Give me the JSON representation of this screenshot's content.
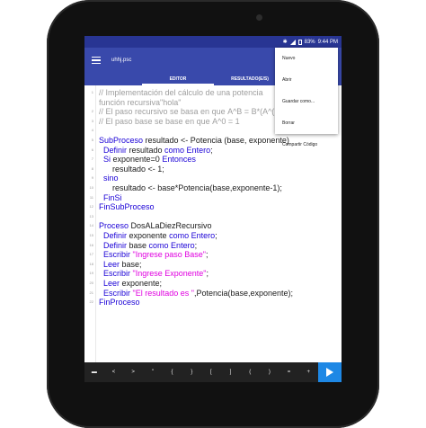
{
  "status": {
    "bt": "✱",
    "battery": "83%",
    "time": "9:44 PM"
  },
  "appbar": {
    "filename": "uhhj.psc"
  },
  "tabs": [
    "EDITOR",
    "RESULTADO(E/S)"
  ],
  "menu": [
    "Nuevo",
    "Abrir",
    "Guardar como...",
    "Borrar",
    "Compartir Código"
  ],
  "code_lines": [
    {
      "n": "1",
      "parts": [
        {
          "c": "cm",
          "t": "// Implementación del cálculo de una potencia"
        }
      ]
    },
    {
      "n": "",
      "parts": [
        {
          "c": "cm",
          "t": "función recursiva\"hola\""
        }
      ]
    },
    {
      "n": "2",
      "parts": [
        {
          "c": "cm",
          "t": "// El paso recursivo se basa en que A^B = B*(A^("
        }
      ]
    },
    {
      "n": "3",
      "parts": [
        {
          "c": "cm",
          "t": "// El paso base se base en que A^0 = 1"
        }
      ]
    },
    {
      "n": "4",
      "parts": []
    },
    {
      "n": "5",
      "parts": [
        {
          "c": "kw",
          "t": "SubProceso"
        },
        {
          "c": "nm",
          "t": " resultado <- Potencia (base, exponente)"
        }
      ]
    },
    {
      "n": "6",
      "parts": [
        {
          "c": "kw",
          "t": "  Definir"
        },
        {
          "c": "nm",
          "t": " resultado "
        },
        {
          "c": "kw",
          "t": "como Entero"
        },
        {
          "c": "nm",
          "t": ";"
        }
      ]
    },
    {
      "n": "7",
      "parts": [
        {
          "c": "kw",
          "t": "  Si"
        },
        {
          "c": "nm",
          "t": " exponente=0 "
        },
        {
          "c": "kw",
          "t": "Entonces"
        }
      ]
    },
    {
      "n": "8",
      "parts": [
        {
          "c": "nm",
          "t": "      resultado <- 1;"
        }
      ]
    },
    {
      "n": "9",
      "parts": [
        {
          "c": "kw",
          "t": "  sino"
        }
      ]
    },
    {
      "n": "10",
      "parts": [
        {
          "c": "nm",
          "t": "      resultado <- base*Potencia(base,exponente-1);"
        }
      ]
    },
    {
      "n": "11",
      "parts": [
        {
          "c": "kw",
          "t": "  FinSi"
        }
      ]
    },
    {
      "n": "12",
      "parts": [
        {
          "c": "kw",
          "t": "FinSubProceso"
        }
      ]
    },
    {
      "n": "13",
      "parts": []
    },
    {
      "n": "14",
      "parts": [
        {
          "c": "kw",
          "t": "Proceso"
        },
        {
          "c": "nm",
          "t": " DosALaDiezRecursivo"
        }
      ]
    },
    {
      "n": "15",
      "parts": [
        {
          "c": "kw",
          "t": "  Definir"
        },
        {
          "c": "nm",
          "t": " exponente "
        },
        {
          "c": "kw",
          "t": "como Entero"
        },
        {
          "c": "nm",
          "t": ";"
        }
      ]
    },
    {
      "n": "16",
      "parts": [
        {
          "c": "kw",
          "t": "  Definir"
        },
        {
          "c": "nm",
          "t": " base "
        },
        {
          "c": "kw",
          "t": "como Entero"
        },
        {
          "c": "nm",
          "t": ";"
        }
      ]
    },
    {
      "n": "17",
      "parts": [
        {
          "c": "kw",
          "t": "  Escribir "
        },
        {
          "c": "st",
          "t": "\"Ingrese paso Base\""
        },
        {
          "c": "nm",
          "t": ";"
        }
      ]
    },
    {
      "n": "18",
      "parts": [
        {
          "c": "kw",
          "t": "  Leer"
        },
        {
          "c": "nm",
          "t": " base;"
        }
      ]
    },
    {
      "n": "19",
      "parts": [
        {
          "c": "kw",
          "t": "  Escribir "
        },
        {
          "c": "st",
          "t": "\"Ingrese Exponente\""
        },
        {
          "c": "nm",
          "t": ";"
        }
      ]
    },
    {
      "n": "20",
      "parts": [
        {
          "c": "kw",
          "t": "  Leer"
        },
        {
          "c": "nm",
          "t": " exponente;"
        }
      ]
    },
    {
      "n": "21",
      "parts": [
        {
          "c": "kw",
          "t": "  Escribir "
        },
        {
          "c": "st",
          "t": "\"El resultado es \""
        },
        {
          "c": "nm",
          "t": ",Potencia(base,exponente);"
        }
      ]
    },
    {
      "n": "22",
      "parts": [
        {
          "c": "kw",
          "t": "FinProceso"
        }
      ]
    }
  ],
  "keys": [
    "▬",
    "<",
    ">",
    "\"",
    "{",
    "}",
    "[",
    "]",
    "(",
    ")",
    "=",
    "+"
  ],
  "colors": {
    "appbar": "#3949ab",
    "statusbar": "#283593",
    "keyword": "#1a00d6",
    "string": "#e000e0",
    "comment": "#9e9e9e",
    "run": "#1e88e5"
  }
}
